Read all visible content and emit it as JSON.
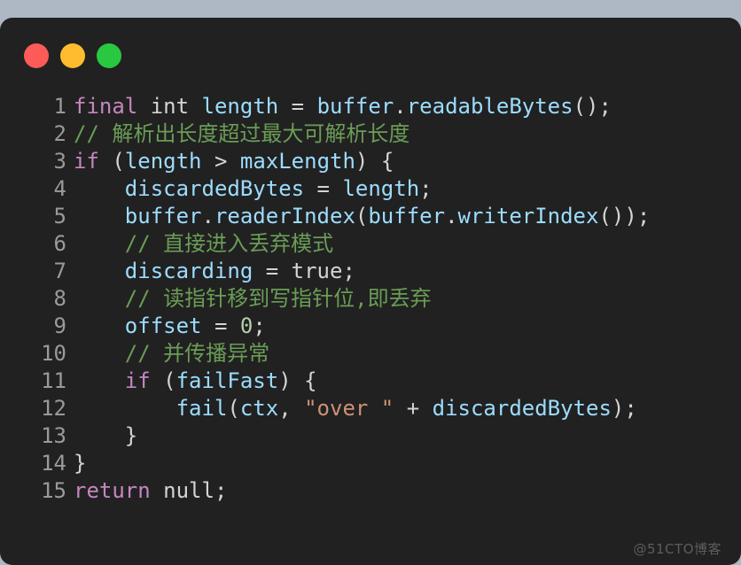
{
  "window": {
    "background_color": "#adb8c4",
    "card_color": "#212121",
    "controls": [
      {
        "name": "close",
        "color": "#fc5b57"
      },
      {
        "name": "minimize",
        "color": "#febc2e"
      },
      {
        "name": "maximize",
        "color": "#28c840"
      }
    ]
  },
  "editor": {
    "language": "java",
    "theme_colors": {
      "keyword": "#c586c0",
      "identifier": "#9cdcfe",
      "comment": "#6a9d56",
      "string": "#ce9178",
      "number": "#b5cea8",
      "plain": "#d4d4d4",
      "line_number": "#9a9a9a"
    },
    "lines": [
      {
        "number": "1",
        "tokens": [
          {
            "t": "final",
            "c": "kw"
          },
          {
            "t": " ",
            "c": "op"
          },
          {
            "t": "int",
            "c": "typ"
          },
          {
            "t": " ",
            "c": "op"
          },
          {
            "t": "length",
            "c": "id"
          },
          {
            "t": " = ",
            "c": "op"
          },
          {
            "t": "buffer",
            "c": "id"
          },
          {
            "t": ".",
            "c": "op"
          },
          {
            "t": "readableBytes",
            "c": "id"
          },
          {
            "t": "();",
            "c": "op"
          }
        ]
      },
      {
        "number": "2",
        "tokens": [
          {
            "t": "// 解析出长度超过最大可解析长度",
            "c": "cm"
          }
        ]
      },
      {
        "number": "3",
        "tokens": [
          {
            "t": "if",
            "c": "kw"
          },
          {
            "t": " (",
            "c": "op"
          },
          {
            "t": "length",
            "c": "id"
          },
          {
            "t": " > ",
            "c": "op"
          },
          {
            "t": "maxLength",
            "c": "id"
          },
          {
            "t": ") {",
            "c": "op"
          }
        ]
      },
      {
        "number": "4",
        "tokens": [
          {
            "t": "    ",
            "c": "op"
          },
          {
            "t": "discardedBytes",
            "c": "id"
          },
          {
            "t": " = ",
            "c": "op"
          },
          {
            "t": "length",
            "c": "id"
          },
          {
            "t": ";",
            "c": "op"
          }
        ]
      },
      {
        "number": "5",
        "tokens": [
          {
            "t": "    ",
            "c": "op"
          },
          {
            "t": "buffer",
            "c": "id"
          },
          {
            "t": ".",
            "c": "op"
          },
          {
            "t": "readerIndex",
            "c": "id"
          },
          {
            "t": "(",
            "c": "op"
          },
          {
            "t": "buffer",
            "c": "id"
          },
          {
            "t": ".",
            "c": "op"
          },
          {
            "t": "writerIndex",
            "c": "id"
          },
          {
            "t": "());",
            "c": "op"
          }
        ]
      },
      {
        "number": "6",
        "tokens": [
          {
            "t": "    ",
            "c": "op"
          },
          {
            "t": "// 直接进入丢弃模式",
            "c": "cm"
          }
        ]
      },
      {
        "number": "7",
        "tokens": [
          {
            "t": "    ",
            "c": "op"
          },
          {
            "t": "discarding",
            "c": "id"
          },
          {
            "t": " = ",
            "c": "op"
          },
          {
            "t": "true",
            "c": "lit"
          },
          {
            "t": ";",
            "c": "op"
          }
        ]
      },
      {
        "number": "8",
        "tokens": [
          {
            "t": "    ",
            "c": "op"
          },
          {
            "t": "// 读指针移到写指针位,即丢弃",
            "c": "cm"
          }
        ]
      },
      {
        "number": "9",
        "tokens": [
          {
            "t": "    ",
            "c": "op"
          },
          {
            "t": "offset",
            "c": "id"
          },
          {
            "t": " = ",
            "c": "op"
          },
          {
            "t": "0",
            "c": "num"
          },
          {
            "t": ";",
            "c": "op"
          }
        ]
      },
      {
        "number": "10",
        "tokens": [
          {
            "t": "    ",
            "c": "op"
          },
          {
            "t": "// 并传播异常",
            "c": "cm"
          }
        ]
      },
      {
        "number": "11",
        "tokens": [
          {
            "t": "    ",
            "c": "op"
          },
          {
            "t": "if",
            "c": "kw"
          },
          {
            "t": " (",
            "c": "op"
          },
          {
            "t": "failFast",
            "c": "id"
          },
          {
            "t": ") {",
            "c": "op"
          }
        ]
      },
      {
        "number": "12",
        "tokens": [
          {
            "t": "        ",
            "c": "op"
          },
          {
            "t": "fail",
            "c": "id"
          },
          {
            "t": "(",
            "c": "op"
          },
          {
            "t": "ctx",
            "c": "id"
          },
          {
            "t": ", ",
            "c": "op"
          },
          {
            "t": "\"over \"",
            "c": "str"
          },
          {
            "t": " + ",
            "c": "op"
          },
          {
            "t": "discardedBytes",
            "c": "id"
          },
          {
            "t": ");",
            "c": "op"
          }
        ]
      },
      {
        "number": "13",
        "tokens": [
          {
            "t": "    }",
            "c": "op"
          }
        ]
      },
      {
        "number": "14",
        "tokens": [
          {
            "t": "}",
            "c": "op"
          }
        ]
      },
      {
        "number": "15",
        "tokens": [
          {
            "t": "return",
            "c": "kw"
          },
          {
            "t": " ",
            "c": "op"
          },
          {
            "t": "null",
            "c": "lit"
          },
          {
            "t": ";",
            "c": "op"
          }
        ]
      }
    ]
  },
  "watermark": {
    "text": "@51CTO博客"
  }
}
